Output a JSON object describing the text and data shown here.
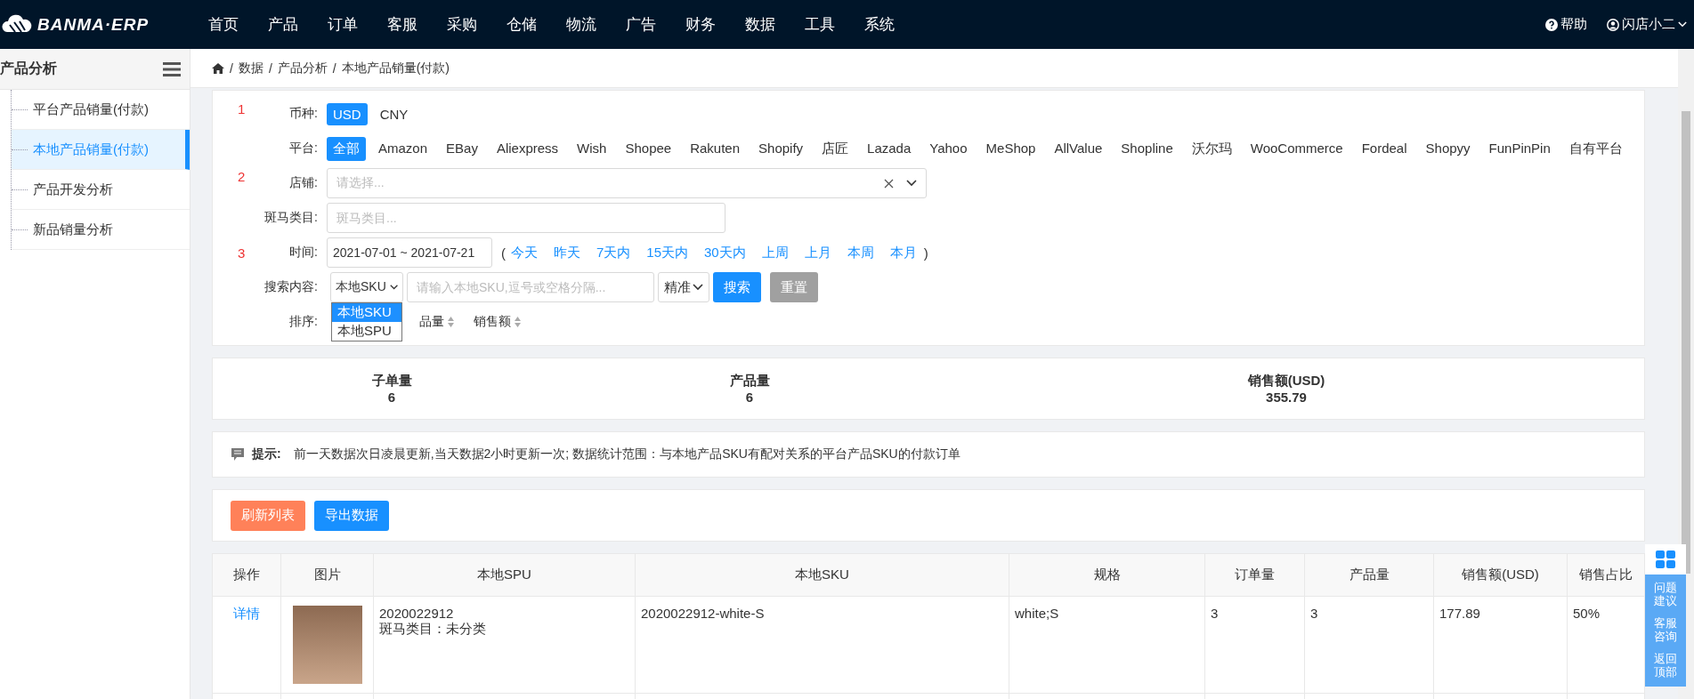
{
  "topbar": {
    "logo": "BANMA·ERP",
    "nav": [
      "首页",
      "产品",
      "订单",
      "客服",
      "采购",
      "仓储",
      "物流",
      "广告",
      "财务",
      "数据",
      "工具",
      "系统"
    ],
    "help": "帮助",
    "user": "闪店小二"
  },
  "sidebar": {
    "title": "产品分析",
    "items": [
      {
        "label": "平台产品销量(付款)",
        "selected": false
      },
      {
        "label": "本地产品销量(付款)",
        "selected": true
      },
      {
        "label": "产品开发分析",
        "selected": false
      },
      {
        "label": "新品销量分析",
        "selected": false
      }
    ]
  },
  "breadcrumb": {
    "separator": "/",
    "items": [
      "数据",
      "产品分析",
      "本地产品销量(付款)"
    ]
  },
  "filter": {
    "annotations": [
      "1",
      "2",
      "3"
    ],
    "currency": {
      "label": "币种:",
      "options": [
        {
          "label": "USD",
          "selected": true
        },
        {
          "label": "CNY",
          "selected": false
        }
      ]
    },
    "platform": {
      "label": "平台:",
      "options": [
        {
          "label": "全部",
          "selected": true
        },
        {
          "label": "Amazon",
          "selected": false
        },
        {
          "label": "EBay",
          "selected": false
        },
        {
          "label": "Aliexpress",
          "selected": false
        },
        {
          "label": "Wish",
          "selected": false
        },
        {
          "label": "Shopee",
          "selected": false
        },
        {
          "label": "Rakuten",
          "selected": false
        },
        {
          "label": "Shopify",
          "selected": false
        },
        {
          "label": "店匠",
          "selected": false
        },
        {
          "label": "Lazada",
          "selected": false
        },
        {
          "label": "Yahoo",
          "selected": false
        },
        {
          "label": "MeShop",
          "selected": false
        },
        {
          "label": "AllValue",
          "selected": false
        },
        {
          "label": "Shopline",
          "selected": false
        },
        {
          "label": "沃尔玛",
          "selected": false
        },
        {
          "label": "WooCommerce",
          "selected": false
        },
        {
          "label": "Fordeal",
          "selected": false
        },
        {
          "label": "Shopyy",
          "selected": false
        },
        {
          "label": "FunPinPin",
          "selected": false
        },
        {
          "label": "自有平台",
          "selected": false
        }
      ]
    },
    "store": {
      "label": "店铺:",
      "placeholder": "请选择..."
    },
    "category": {
      "label": "斑马类目:",
      "placeholder": "斑马类目..."
    },
    "time": {
      "label": "时间:",
      "value": "2021-07-01 ~ 2021-07-21",
      "open": "(",
      "close": ")",
      "quick": [
        "今天",
        "昨天",
        "7天内",
        "15天内",
        "30天内",
        "上周",
        "上月",
        "本周",
        "本月"
      ]
    },
    "search": {
      "label": "搜索内容:",
      "field": "本地SKU",
      "options": [
        {
          "label": "本地SKU",
          "selected": true
        },
        {
          "label": "本地SPU",
          "selected": false
        }
      ],
      "placeholder": "请输入本地SKU,逗号或空格分隔...",
      "match": "精准",
      "search_button": "搜索",
      "reset_button": "重置"
    },
    "sort": {
      "label": "排序:",
      "items": [
        "品量",
        "销售额"
      ]
    }
  },
  "stats": [
    {
      "label": "子单量",
      "value": "6"
    },
    {
      "label": "产品量",
      "value": "6"
    },
    {
      "label": "销售额(USD)",
      "value": "355.79"
    }
  ],
  "tips": {
    "title": "提示:",
    "text": "前一天数据次日凌晨更新,当天数据2小时更新一次; 数据统计范围：与本地产品SKU有配对关系的平台产品SKU的付款订单"
  },
  "actions": [
    {
      "label": "刷新列表",
      "kind": "refresh"
    },
    {
      "label": "导出数据",
      "kind": "export"
    }
  ],
  "table": {
    "columns": [
      "操作",
      "图片",
      "本地SPU",
      "本地SKU",
      "规格",
      "订单量",
      "产品量",
      "销售额(USD)",
      "销售占比"
    ],
    "rows": [
      {
        "action": "详情",
        "spu": "2020022912",
        "category": "斑马类目：未分类",
        "sku": "2020022912-white-S",
        "spec": "white;S",
        "orders": "3",
        "quantity": "3",
        "sales": "177.89",
        "share": "50%"
      }
    ]
  },
  "float_widget": {
    "items": [
      "问题建议",
      "客服咨询",
      "返回顶部"
    ]
  }
}
